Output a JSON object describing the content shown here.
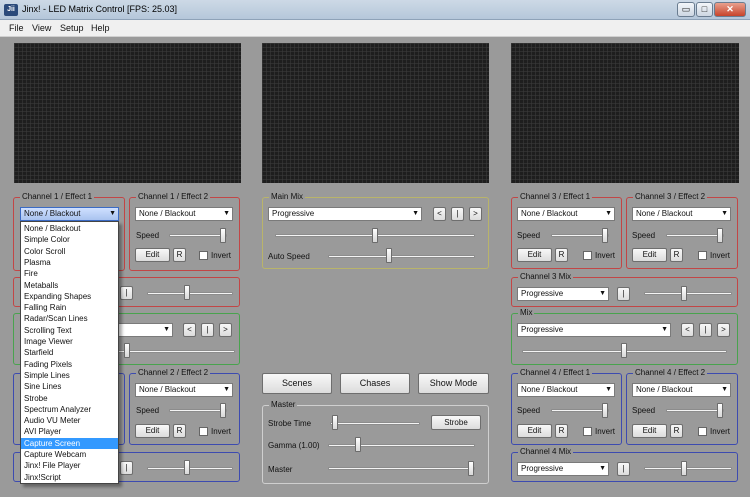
{
  "window": {
    "title": "Jinx! - LED Matrix Control [FPS: 25.03]",
    "app_icon_text": "Jii",
    "minimize_glyph": "▭",
    "maximize_glyph": "□",
    "close_glyph": "✕"
  },
  "menu": {
    "items": [
      "File",
      "View",
      "Setup",
      "Help"
    ]
  },
  "labels": {
    "speed": "Speed",
    "invert": "Invert",
    "edit": "Edit",
    "r": "R",
    "auto_speed": "Auto Speed",
    "strobe_time": "Strobe Time",
    "gamma": "Gamma (1.00)",
    "master": "Master"
  },
  "channels": {
    "ch1_effect1": {
      "title": "Channel 1 / Effect 1",
      "value": "None / Blackout"
    },
    "ch1_effect2": {
      "title": "Channel 1 / Effect 2",
      "value": "None / Blackout"
    },
    "ch2_effect2": {
      "title": "Channel 2 / Effect 2",
      "value": "None / Blackout"
    },
    "ch3_effect1": {
      "title": "Channel 3 / Effect 1",
      "value": "None / Blackout"
    },
    "ch3_effect2": {
      "title": "Channel 3 / Effect 2",
      "value": "None / Blackout"
    },
    "ch3_mix": {
      "title": "Channel 3 Mix",
      "value": "Progressive"
    },
    "mix": {
      "title": "Mix",
      "value": "Progressive"
    },
    "ch4_effect1": {
      "title": "Channel 4 / Effect 1",
      "value": "None / Blackout"
    },
    "ch4_effect2": {
      "title": "Channel 4 / Effect 2",
      "value": "None / Blackout"
    },
    "ch4_mix": {
      "title": "Channel 4 Mix",
      "value": "Progressive"
    }
  },
  "main_mix": {
    "title": "Main Mix",
    "value": "Progressive",
    "prev": "<",
    "pause": "|",
    "next": ">"
  },
  "master": {
    "title": "Master",
    "strobe_button": "Strobe"
  },
  "mode_buttons": {
    "scenes": "Scenes",
    "chases": "Chases",
    "show_mode": "Show Mode"
  },
  "dropdown": {
    "items": [
      "None / Blackout",
      "Simple Color",
      "Color Scroll",
      "Plasma",
      "Fire",
      "Metaballs",
      "Expanding Shapes",
      "Falling Rain",
      "Radar/Scan Lines",
      "Scrolling Text",
      "Image Viewer",
      "Starfield",
      "Fading Pixels",
      "Simple Lines",
      "Sine Lines",
      "Strobe",
      "Spectrum Analyzer",
      "Audio VU Meter",
      "AVI Player",
      "Capture Screen",
      "Capture Webcam",
      "Jinx! File Player",
      "Jinx!Script"
    ],
    "highlighted": "Capture Screen"
  }
}
